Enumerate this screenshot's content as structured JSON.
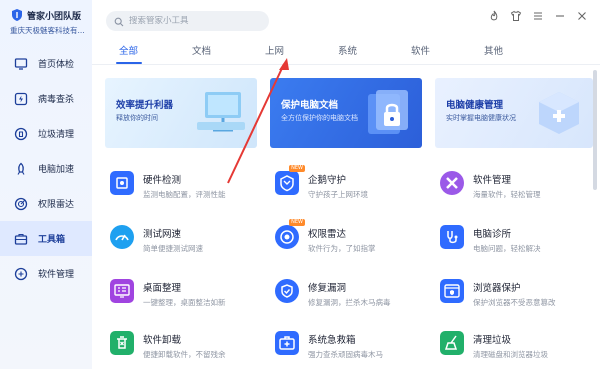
{
  "app": {
    "title": "管家小团队版",
    "subtitle": "重庆天极魅客科技有..."
  },
  "sidebar": {
    "items": [
      {
        "label": "首页体检",
        "icon": "monitor-icon",
        "active": false
      },
      {
        "label": "病毒查杀",
        "icon": "lightning-shield-icon",
        "active": false
      },
      {
        "label": "垃圾清理",
        "icon": "trash-cycle-icon",
        "active": false
      },
      {
        "label": "电脑加速",
        "icon": "rocket-icon",
        "active": false
      },
      {
        "label": "权限雷达",
        "icon": "radar-icon",
        "active": false
      },
      {
        "label": "工具箱",
        "icon": "toolbox-icon",
        "active": true
      },
      {
        "label": "软件管理",
        "icon": "apps-icon",
        "active": false
      }
    ]
  },
  "search": {
    "placeholder": "搜索管家小工具"
  },
  "tabs": [
    {
      "label": "全部",
      "active": true
    },
    {
      "label": "文档",
      "active": false
    },
    {
      "label": "上网",
      "active": false
    },
    {
      "label": "系统",
      "active": false
    },
    {
      "label": "软件",
      "active": false
    },
    {
      "label": "其他",
      "active": false
    }
  ],
  "banners": [
    {
      "title": "效率提升利器",
      "sub": "释放你的时间"
    },
    {
      "title": "保护电脑文档",
      "sub": "全方位保护你的电脑文档"
    },
    {
      "title": "电脑健康管理",
      "sub": "实时掌握电脑健康状况"
    }
  ],
  "tools": [
    {
      "name": "硬件检测",
      "desc": "监测电脑配置，评测性能",
      "icon": "chip-icon",
      "color": "#2f6bff",
      "badge": ""
    },
    {
      "name": "企鹅守护",
      "desc": "守护孩子上网环境",
      "icon": "penguin-shield-icon",
      "color": "#2f6bff",
      "badge": "NEW"
    },
    {
      "name": "软件管理",
      "desc": "海量软件，轻松管理",
      "icon": "apps-icon",
      "color": "#9b59e8",
      "badge": ""
    },
    {
      "name": "测试网速",
      "desc": "简单便捷测试网速",
      "icon": "speedometer-icon",
      "color": "#1ea0f0",
      "badge": ""
    },
    {
      "name": "权限雷达",
      "desc": "软件行为，了如指掌",
      "icon": "radar-icon",
      "color": "#2f6bff",
      "badge": "NEW"
    },
    {
      "name": "电脑诊所",
      "desc": "电脑问题，轻松解决",
      "icon": "stethoscope-icon",
      "color": "#2f6bff",
      "badge": ""
    },
    {
      "name": "桌面整理",
      "desc": "一键整理，桌面整洁如新",
      "icon": "desktop-grid-icon",
      "color": "#a044e0",
      "badge": ""
    },
    {
      "name": "修复漏洞",
      "desc": "修复漏洞，拦杀木马病毒",
      "icon": "shield-repair-icon",
      "color": "#2f6bff",
      "badge": ""
    },
    {
      "name": "浏览器保护",
      "desc": "保护浏览器不受恶意篡改",
      "icon": "browser-shield-icon",
      "color": "#2f6bff",
      "badge": ""
    },
    {
      "name": "软件卸载",
      "desc": "便捷卸载软件，不留残余",
      "icon": "uninstall-icon",
      "color": "#21b06a",
      "badge": ""
    },
    {
      "name": "系统急救箱",
      "desc": "强力查杀顽固病毒木马",
      "icon": "first-aid-icon",
      "color": "#2f6bff",
      "badge": ""
    },
    {
      "name": "清理垃圾",
      "desc": "清理磁盘和浏览器垃圾",
      "icon": "cleanup-icon",
      "color": "#21b06a",
      "badge": ""
    }
  ],
  "colors": {
    "accent": "#2a64e8",
    "annotation_arrow": "#e53935"
  }
}
